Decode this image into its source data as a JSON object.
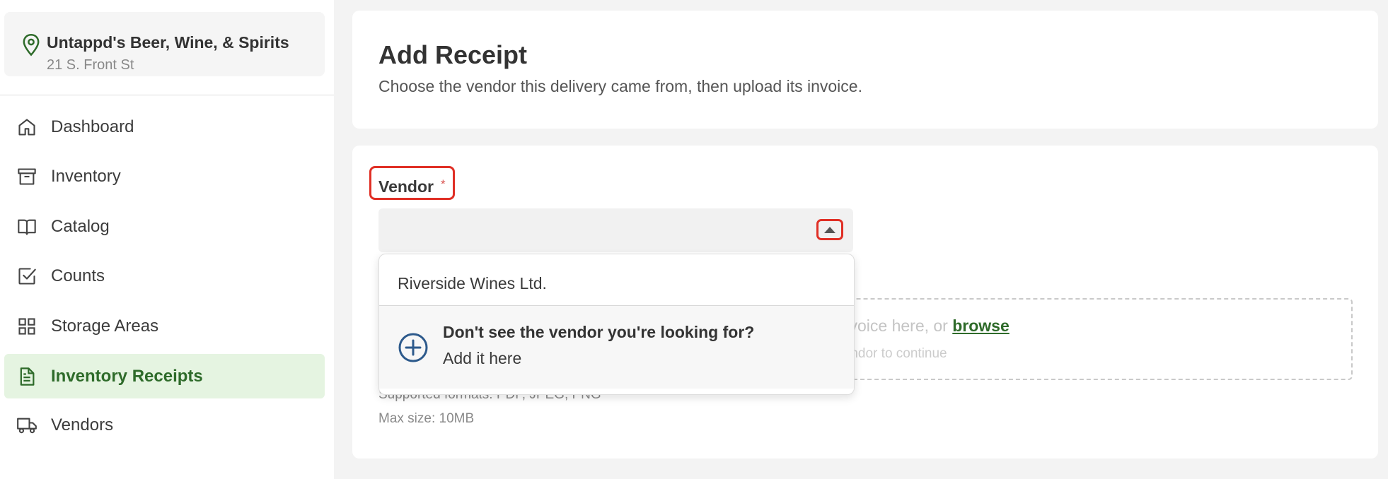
{
  "location": {
    "name": "Untappd's Beer, Wine, & Spirits",
    "address": "21 S. Front St"
  },
  "sidebar": {
    "items": [
      {
        "label": "Dashboard",
        "icon": "home-icon",
        "active": false
      },
      {
        "label": "Inventory",
        "icon": "archive-box-icon",
        "active": false
      },
      {
        "label": "Catalog",
        "icon": "book-icon",
        "active": false
      },
      {
        "label": "Counts",
        "icon": "checkbox-icon",
        "active": false
      },
      {
        "label": "Storage Areas",
        "icon": "grid-icon",
        "active": false
      },
      {
        "label": "Inventory Receipts",
        "icon": "document-icon",
        "active": true
      },
      {
        "label": "Vendors",
        "icon": "truck-icon",
        "active": false
      }
    ]
  },
  "header": {
    "title": "Add Receipt",
    "subtitle": "Choose the vendor this delivery came from, then upload its invoice."
  },
  "form": {
    "vendor_label": "Vendor",
    "required_mark": "*",
    "vendor_value": "",
    "dropzone_text": "Drag & drop an invoice here, or",
    "browse_label": "browse",
    "dropzone_hint": "Select a vendor to continue",
    "supported_formats": "Supported formats: PDF, JPEG, PNG",
    "max_size": "Max size: 10MB"
  },
  "dropdown": {
    "options": [
      "Riverside Wines Ltd."
    ],
    "add_title": "Don't see the vendor you're looking for?",
    "add_subtitle": "Add it here"
  },
  "colors": {
    "accent_green": "#2e6b2a",
    "active_bg": "#e5f4e1",
    "highlight_red": "#e02f25",
    "plus_blue": "#2d5a8c"
  }
}
